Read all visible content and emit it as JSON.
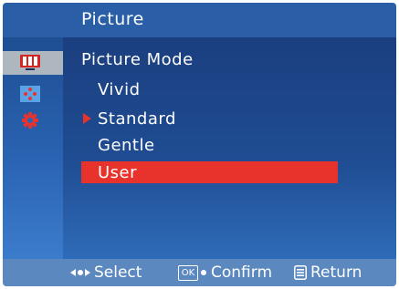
{
  "header": {
    "title": "Picture"
  },
  "sidebar": {
    "items": [
      {
        "icon": "picture-icon",
        "selected": true
      },
      {
        "icon": "dots-icon",
        "selected": false
      },
      {
        "icon": "gear-icon",
        "selected": false
      }
    ]
  },
  "main": {
    "section_label": "Picture Mode",
    "options": [
      {
        "label": "Vivid",
        "pointer": false,
        "active": false
      },
      {
        "label": "Standard",
        "pointer": true,
        "active": false
      },
      {
        "label": "Gentle",
        "pointer": false,
        "active": false
      },
      {
        "label": "User",
        "pointer": false,
        "active": true
      }
    ]
  },
  "footer": {
    "select": {
      "icon": "arrows-icon",
      "label": "Select"
    },
    "confirm": {
      "icon": "ok-icon",
      "icon_text": "OK",
      "label": "Confirm"
    },
    "return": {
      "icon": "menu-icon",
      "label": "Return"
    }
  },
  "colors": {
    "accent": "#e8332d",
    "header_bg": "#2a5fa8",
    "footer_bg": "#5a88bf"
  }
}
